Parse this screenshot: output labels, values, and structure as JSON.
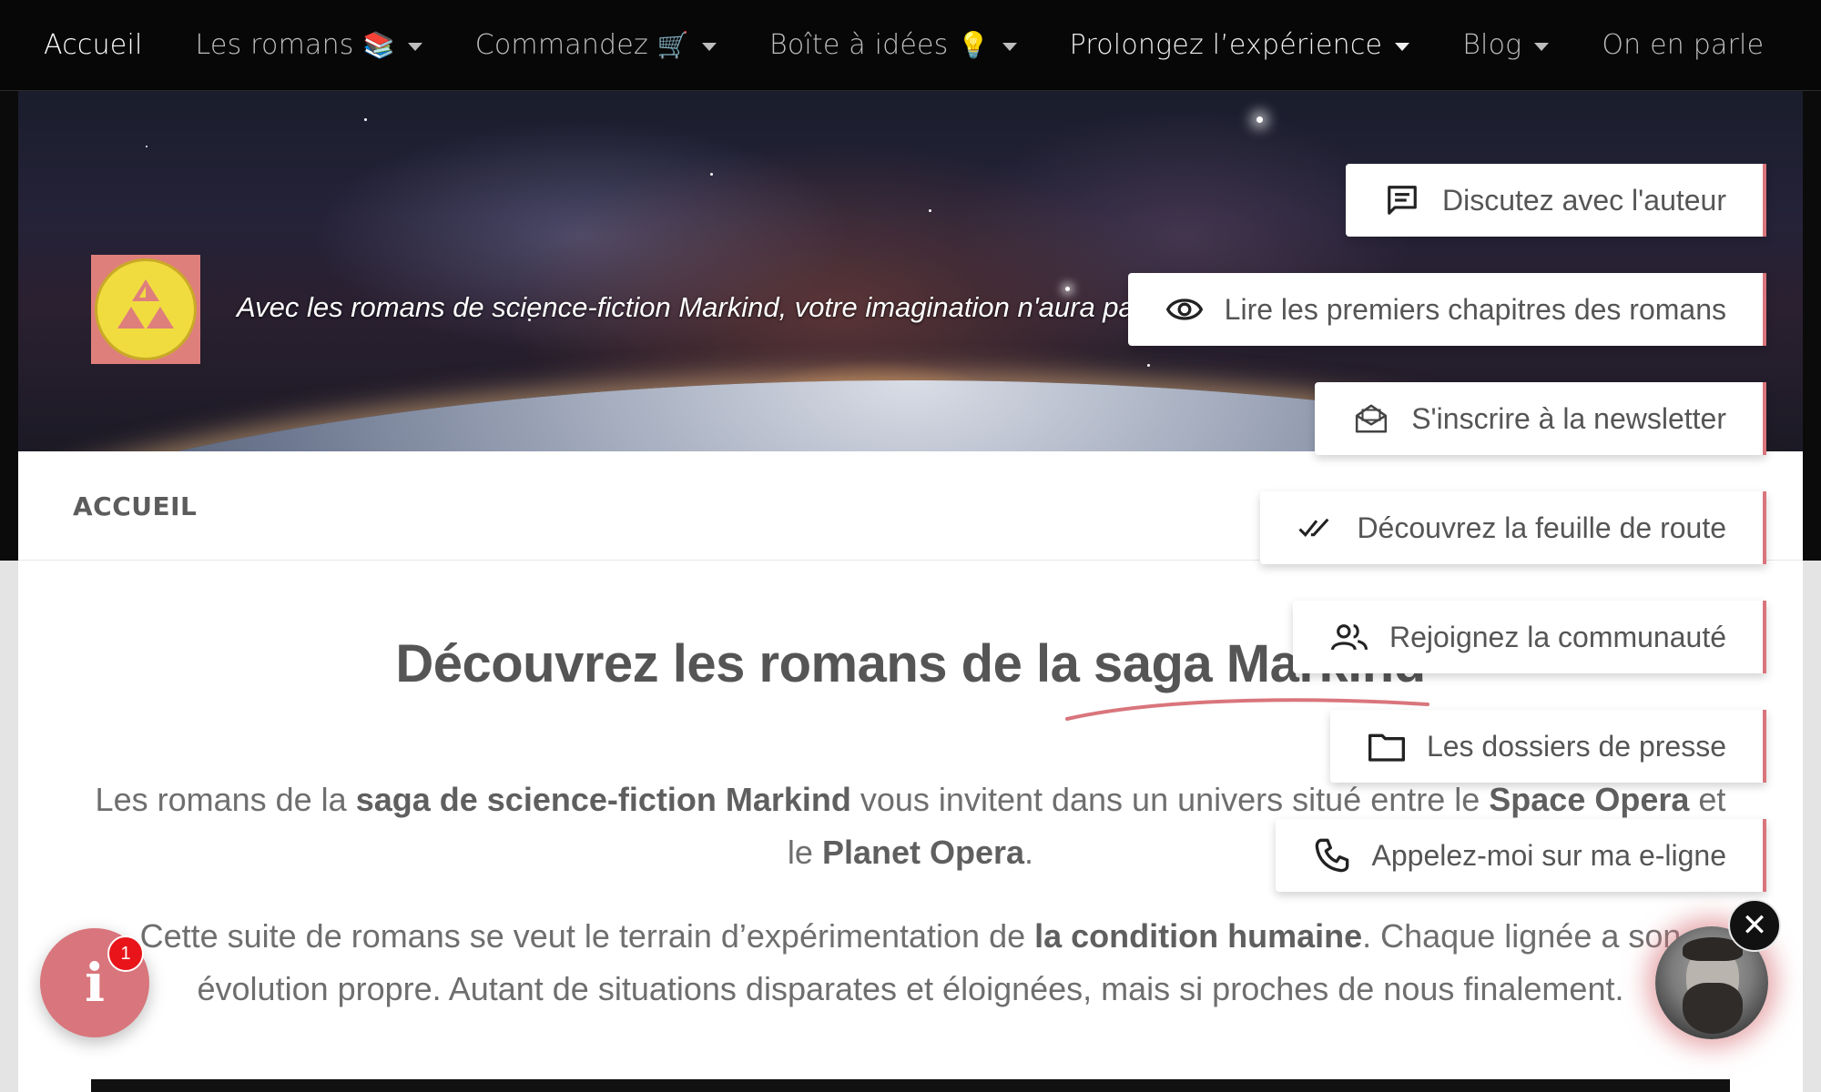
{
  "nav": {
    "items": [
      {
        "label": "Accueil",
        "emoji": "",
        "dropdown": false
      },
      {
        "label": "Les romans",
        "emoji": "📚",
        "dropdown": true
      },
      {
        "label": "Commandez",
        "emoji": "🛒",
        "dropdown": true
      },
      {
        "label": "Boîte à idées",
        "emoji": "💡",
        "dropdown": true
      },
      {
        "label": "Prolongez l’expérience",
        "emoji": "",
        "dropdown": true
      },
      {
        "label": "Blog",
        "emoji": "",
        "dropdown": true
      },
      {
        "label": "On en parle",
        "emoji": "",
        "dropdown": false
      }
    ]
  },
  "hero": {
    "tagline": "Avec les romans de science-fiction Markind, votre imagination n'aura pas de limite"
  },
  "breadcrumb": "ACCUEIL",
  "main": {
    "title": "Découvrez les romans de la saga Markind",
    "para1": {
      "t1": "Les romans de la ",
      "b1": "saga de science-fiction Markind",
      "t2": " vous invitent dans un univers situé entre le ",
      "b2": "Space Opera",
      "t3": " et le ",
      "b3": "Planet Opera",
      "t4": "."
    },
    "para2": {
      "t1": "Cette suite de romans se veut le terrain d’expérimentation de ",
      "b1": "la condition humaine",
      "t2": ". Chaque lignée a son évolution propre. Autant de situations disparates et éloignées, mais si proches de nous finalement."
    }
  },
  "side_actions": [
    {
      "label": "Discutez avec l'auteur",
      "icon": "chat-icon"
    },
    {
      "label": "Lire les premiers chapitres des romans",
      "icon": "eye-icon"
    },
    {
      "label": "S'inscrire à la newsletter",
      "icon": "mail-icon"
    },
    {
      "label": "Découvrez la feuille de route",
      "icon": "double-check-icon"
    },
    {
      "label": "Rejoignez la communauté",
      "icon": "group-icon"
    },
    {
      "label": "Les dossiers de presse",
      "icon": "folder-icon"
    },
    {
      "label": "Appelez-moi sur ma e-ligne",
      "icon": "phone-icon"
    }
  ],
  "info_widget": {
    "badge": "1",
    "icon": "info-icon"
  },
  "close_label": "✕",
  "colors": {
    "accent": "#d9757c",
    "nav_bg": "#070707",
    "badge": "#e8141a",
    "logo_yellow": "#f1dc40"
  }
}
